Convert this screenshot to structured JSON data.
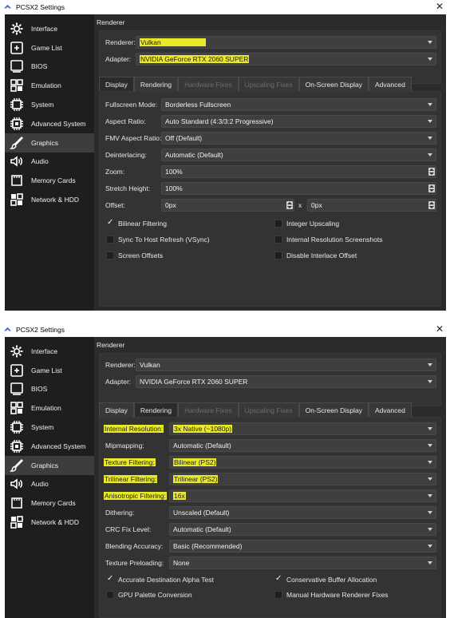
{
  "top": {
    "title": "PCSX2 Settings",
    "close": "✕",
    "sidebar": [
      "Interface",
      "Game List",
      "BIOS",
      "Emulation",
      "System",
      "Advanced System",
      "Graphics",
      "Audio",
      "Memory Cards",
      "Network & HDD"
    ],
    "active_sidebar": "Graphics",
    "section": "Renderer",
    "renderer_label": "Renderer:",
    "renderer_value": "Vulkan",
    "adapter_label": "Adapter:",
    "adapter_value": "NVIDIA GeForce RTX 2060 SUPER",
    "tabs": [
      "Display",
      "Rendering",
      "Hardware Fixes",
      "Upscaling Fixes",
      "On-Screen Display",
      "Advanced"
    ],
    "active_tab": "Display",
    "disabled_tabs": [
      "Hardware Fixes",
      "Upscaling Fixes"
    ],
    "fields": [
      {
        "label": "Fullscreen Mode:",
        "value": "Borderless Fullscreen"
      },
      {
        "label": "Aspect Ratio:",
        "value": "Auto Standard (4:3/3:2 Progressive)"
      },
      {
        "label": "FMV Aspect Ratio:",
        "value": "Off (Default)"
      },
      {
        "label": "Deinterlacing:",
        "value": "Automatic (Default)"
      },
      {
        "label": "Zoom:",
        "value": "100%"
      },
      {
        "label": "Stretch Height:",
        "value": "100%"
      },
      {
        "label": "Offset:",
        "value_x": "0px",
        "separator": "x",
        "value_y": "0px"
      }
    ],
    "checks": [
      {
        "label": "Bilinear Filtering",
        "checked": true
      },
      {
        "label": "Integer Upscaling",
        "checked": false
      },
      {
        "label": "Sync To Host Refresh (VSync)",
        "checked": false
      },
      {
        "label": "Internal Resolution Screenshots",
        "checked": false
      },
      {
        "label": "Screen Offsets",
        "checked": false
      },
      {
        "label": "Disable Interlace Offset",
        "checked": false
      }
    ]
  },
  "bottom": {
    "title": "PCSX2 Settings",
    "close": "✕",
    "section": "Renderer",
    "renderer_label": "Renderer:",
    "renderer_value": "Vulkan",
    "adapter_label": "Adapter:",
    "adapter_value": "NVIDIA GeForce RTX 2060 SUPER",
    "active_tab": "Rendering",
    "fields": [
      {
        "label": "Internal Resolution:",
        "value": "3x Native (~1080p)"
      },
      {
        "label": "Mipmapping:",
        "value": "Automatic (Default)"
      },
      {
        "label": "Texture Filtering:",
        "value": "Bilinear (PS2)"
      },
      {
        "label": "Trilinear Filtering:",
        "value": "Trilinear (PS2)"
      },
      {
        "label": "Anisotropic Filtering:",
        "value": "16x"
      },
      {
        "label": "Dithering:",
        "value": "Unscaled (Default)"
      },
      {
        "label": "CRC Fix Level:",
        "value": "Automatic (Default)"
      },
      {
        "label": "Blending Accuracy:",
        "value": "Basic (Recommended)"
      },
      {
        "label": "Texture Preloading:",
        "value": "None"
      }
    ],
    "checks": [
      {
        "label": "Accurate Destination Alpha Test",
        "checked": true
      },
      {
        "label": "Conservative Buffer Allocation",
        "checked": true
      },
      {
        "label": "GPU Palette Conversion",
        "checked": false
      },
      {
        "label": "Manual Hardware Renderer Fixes",
        "checked": false
      }
    ]
  },
  "colors": {
    "highlight": "#e9e92a",
    "panel": "#333333",
    "sidebar": "#1e1e1e"
  }
}
